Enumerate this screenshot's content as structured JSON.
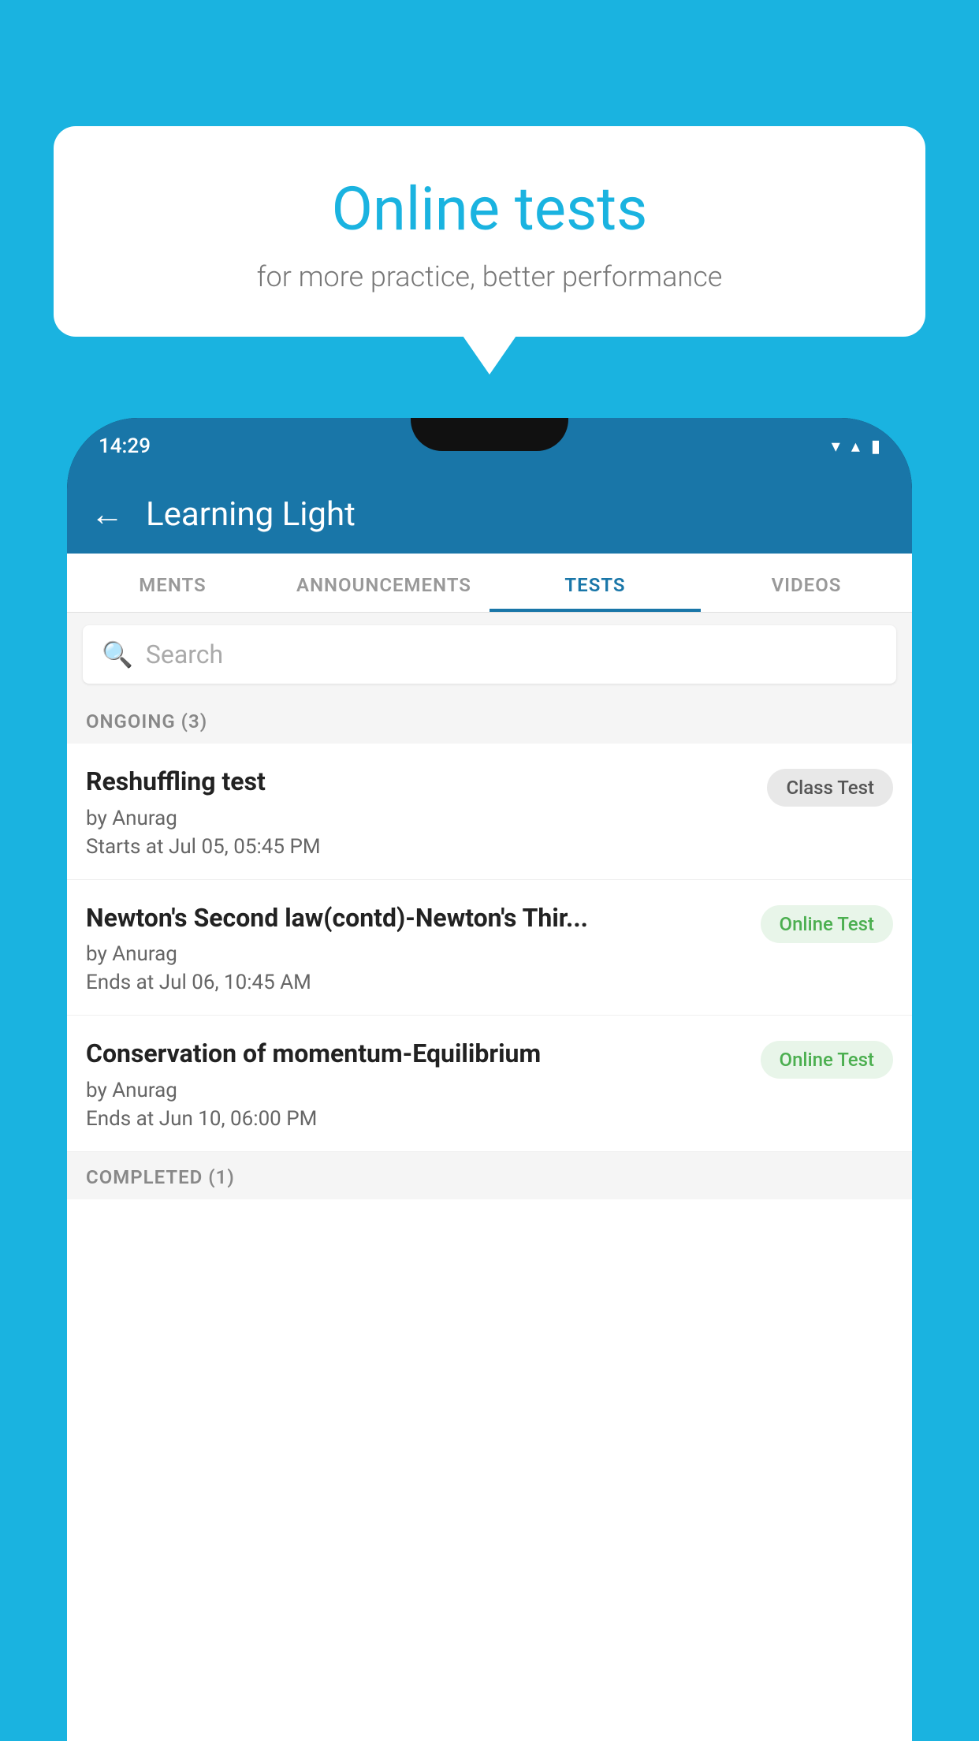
{
  "background": {
    "color": "#1ab3e0"
  },
  "speech_bubble": {
    "title": "Online tests",
    "subtitle": "for more practice, better performance"
  },
  "phone": {
    "status_bar": {
      "time": "14:29",
      "icons": [
        "wifi",
        "signal",
        "battery"
      ]
    },
    "app_bar": {
      "back_label": "←",
      "title": "Learning Light"
    },
    "tabs": [
      {
        "label": "MENTS",
        "active": false
      },
      {
        "label": "ANNOUNCEMENTS",
        "active": false
      },
      {
        "label": "TESTS",
        "active": true
      },
      {
        "label": "VIDEOS",
        "active": false
      }
    ],
    "search": {
      "placeholder": "Search",
      "icon": "🔍"
    },
    "sections": [
      {
        "heading": "ONGOING (3)",
        "tests": [
          {
            "title": "Reshuffling test",
            "author": "by Anurag",
            "date": "Starts at  Jul 05, 05:45 PM",
            "badge": "Class Test",
            "badge_type": "class"
          },
          {
            "title": "Newton's Second law(contd)-Newton's Thir...",
            "author": "by Anurag",
            "date": "Ends at  Jul 06, 10:45 AM",
            "badge": "Online Test",
            "badge_type": "online"
          },
          {
            "title": "Conservation of momentum-Equilibrium",
            "author": "by Anurag",
            "date": "Ends at  Jun 10, 06:00 PM",
            "badge": "Online Test",
            "badge_type": "online"
          }
        ]
      }
    ],
    "completed_section_label": "COMPLETED (1)"
  }
}
